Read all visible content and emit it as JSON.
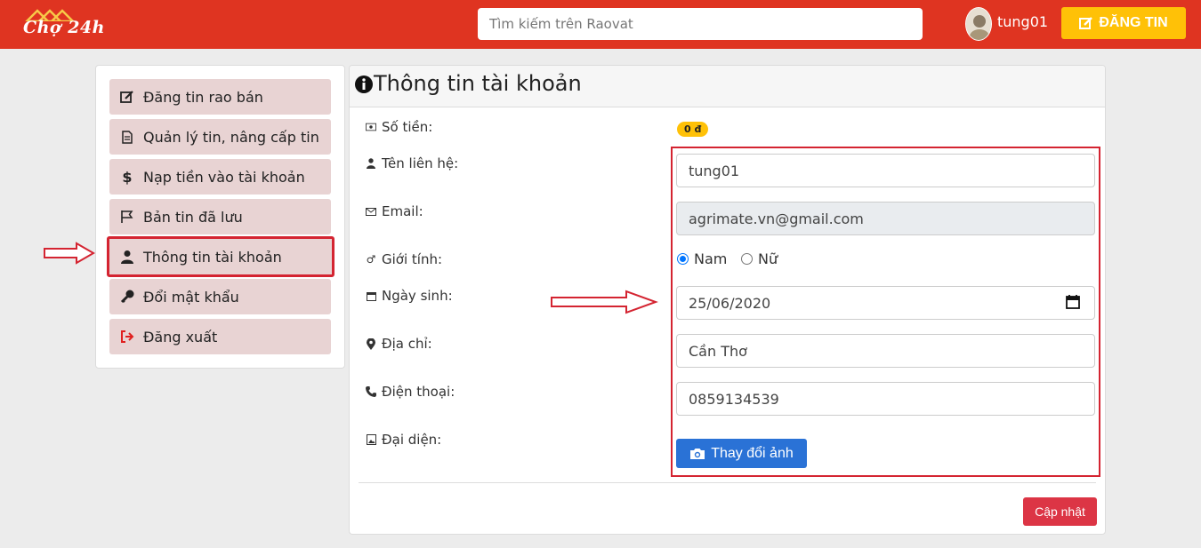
{
  "header": {
    "logo_text": "Chợ 24h",
    "search_placeholder": "Tìm kiếm trên Raovat",
    "username": "tung01",
    "post_button": "ĐĂNG TIN"
  },
  "sidebar": {
    "items": [
      {
        "label": "Đăng tin rao bán",
        "icon": "edit-icon"
      },
      {
        "label": "Quản lý tin, nâng cấp tin",
        "icon": "document-icon"
      },
      {
        "label": "Nạp tiền vào tài khoản",
        "icon": "dollar-icon"
      },
      {
        "label": "Bản tin đã lưu",
        "icon": "flag-icon"
      },
      {
        "label": "Thông tin tài khoản",
        "icon": "user-icon",
        "active": true
      },
      {
        "label": "Đổi mật khẩu",
        "icon": "key-icon"
      },
      {
        "label": "Đăng xuất",
        "icon": "logout-icon"
      }
    ]
  },
  "account": {
    "title": "Thông tin tài khoản",
    "balance_label": "Số tiền:",
    "balance_value": "0 đ",
    "contact_name_label": "Tên liên hệ:",
    "contact_name_value": "tung01",
    "email_label": "Email:",
    "email_value": "agrimate.vn@gmail.com",
    "gender_label": "Giới tính:",
    "gender_options": [
      "Nam",
      "Nữ"
    ],
    "gender_selected": "Nam",
    "birthday_label": "Ngày sinh:",
    "birthday_value": "25/06/2020",
    "address_label": "Địa chỉ:",
    "address_value": "Cần Thơ",
    "phone_label": "Điện thoại:",
    "phone_value": "0859134539",
    "avatar_label": "Đại diện:",
    "change_photo_button": "Thay đổi ảnh",
    "update_button": "Cập nhật"
  },
  "colors": {
    "header_bg": "#df3421",
    "accent_yellow": "#ffc107",
    "menu_bg": "#e8d3d3",
    "highlight_red": "#d42431",
    "primary_blue": "#2a72d6",
    "danger": "#dc3545"
  }
}
